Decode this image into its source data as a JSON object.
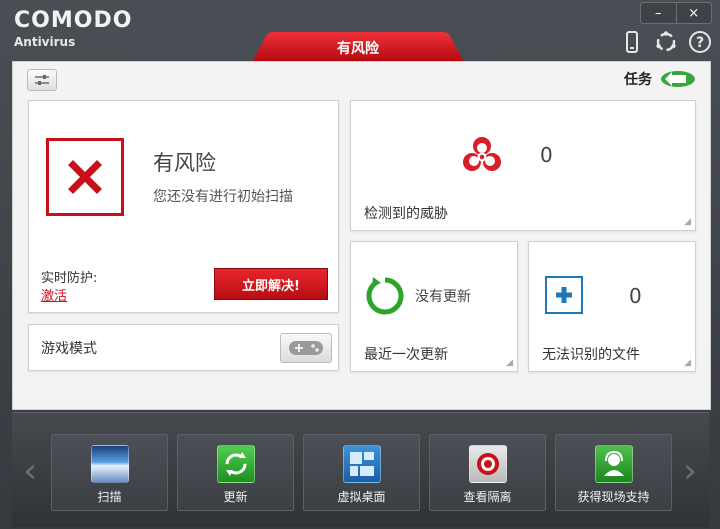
{
  "app": {
    "brand": "COMODO",
    "product": "Antivirus"
  },
  "window_controls": {
    "minimize": "–",
    "close": "×"
  },
  "status_tab": {
    "label": "有风险"
  },
  "toolbar": {
    "task_label": "任务"
  },
  "status_panel": {
    "title": "有风险",
    "subtitle": "您还没有进行初始扫描",
    "realtime_label": "实时防护:",
    "realtime_link": "激活",
    "fix_button": "立即解决!"
  },
  "game_mode": {
    "label": "游戏模式"
  },
  "threats": {
    "count": "0",
    "label": "检测到的威胁"
  },
  "updates": {
    "status": "没有更新",
    "label": "最近一次更新"
  },
  "unrecognized": {
    "count": "0",
    "label": "无法识别的文件"
  },
  "nav": {
    "left_arrow": "‹",
    "right_arrow": "›",
    "items": [
      {
        "label": "扫描",
        "icon": "scan-icon"
      },
      {
        "label": "更新",
        "icon": "update-icon"
      },
      {
        "label": "虚拟桌面",
        "icon": "virtual-desktop-icon"
      },
      {
        "label": "查看隔离",
        "icon": "quarantine-icon"
      },
      {
        "label": "获得现场支持",
        "icon": "support-icon"
      }
    ]
  },
  "colors": {
    "danger": "#c8101b",
    "accent_green": "#2aa52a",
    "accent_blue": "#1f77b7"
  }
}
